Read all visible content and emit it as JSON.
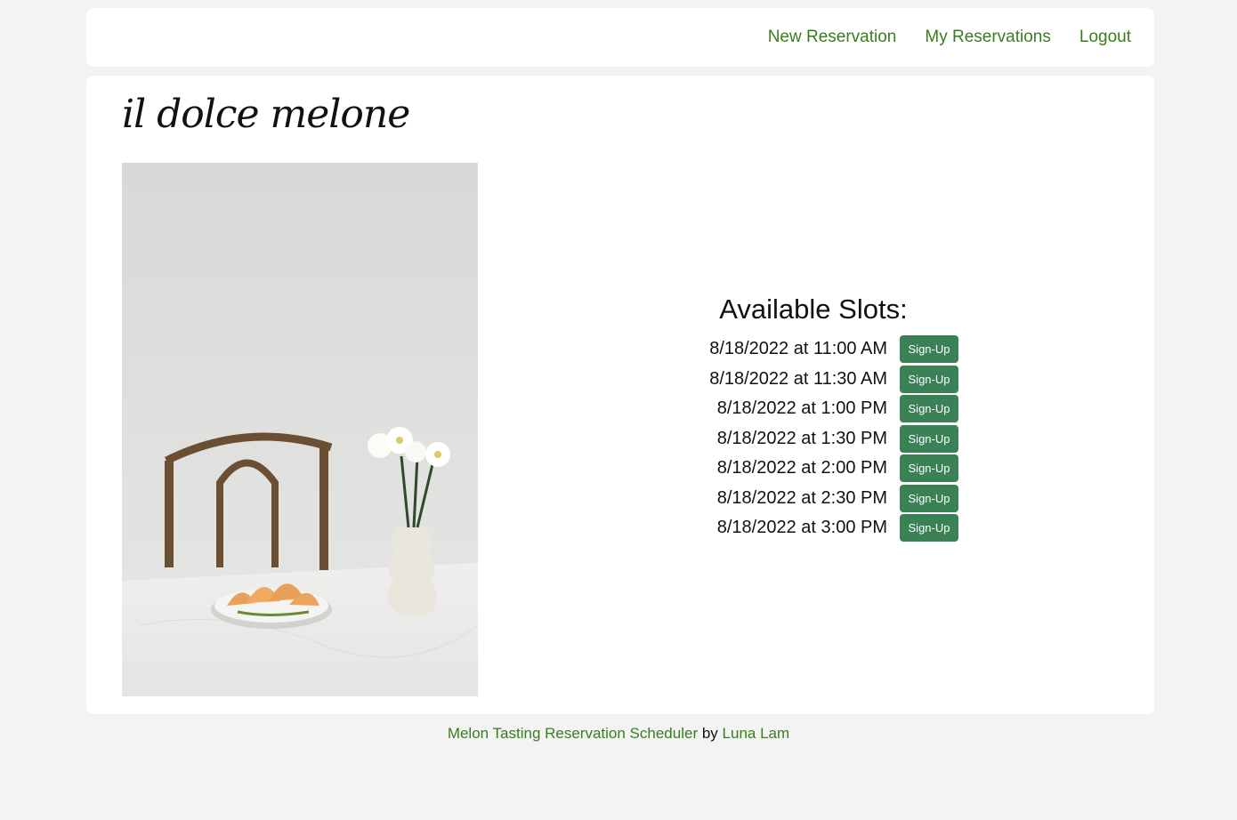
{
  "nav": {
    "links": [
      {
        "label": "New Reservation"
      },
      {
        "label": "My Reservations"
      },
      {
        "label": "Logout"
      }
    ],
    "link_color": "#3a7d1e"
  },
  "brand": {
    "title": "il dolce melone"
  },
  "slots": {
    "heading": "Available Slots:",
    "button_label": "Sign-Up",
    "button_color": "#3a8256",
    "items": [
      {
        "time": "8/18/2022 at 11:00 AM",
        "button": "Sign-Up"
      },
      {
        "time": "8/18/2022 at 11:30 AM",
        "button": "Sign-Up"
      },
      {
        "time": "8/18/2022 at 1:00 PM",
        "button": "Sign-Up"
      },
      {
        "time": "8/18/2022 at 1:30 PM",
        "button": "Sign-Up"
      },
      {
        "time": "8/18/2022 at 2:00 PM",
        "button": "Sign-Up"
      },
      {
        "time": "8/18/2022 at 2:30 PM",
        "button": "Sign-Up"
      },
      {
        "time": "8/18/2022 at 3:00 PM",
        "button": "Sign-Up"
      }
    ]
  },
  "footer": {
    "app_name": "Melon Tasting Reservation Scheduler",
    "by": "by",
    "author": "Luna Lam"
  }
}
